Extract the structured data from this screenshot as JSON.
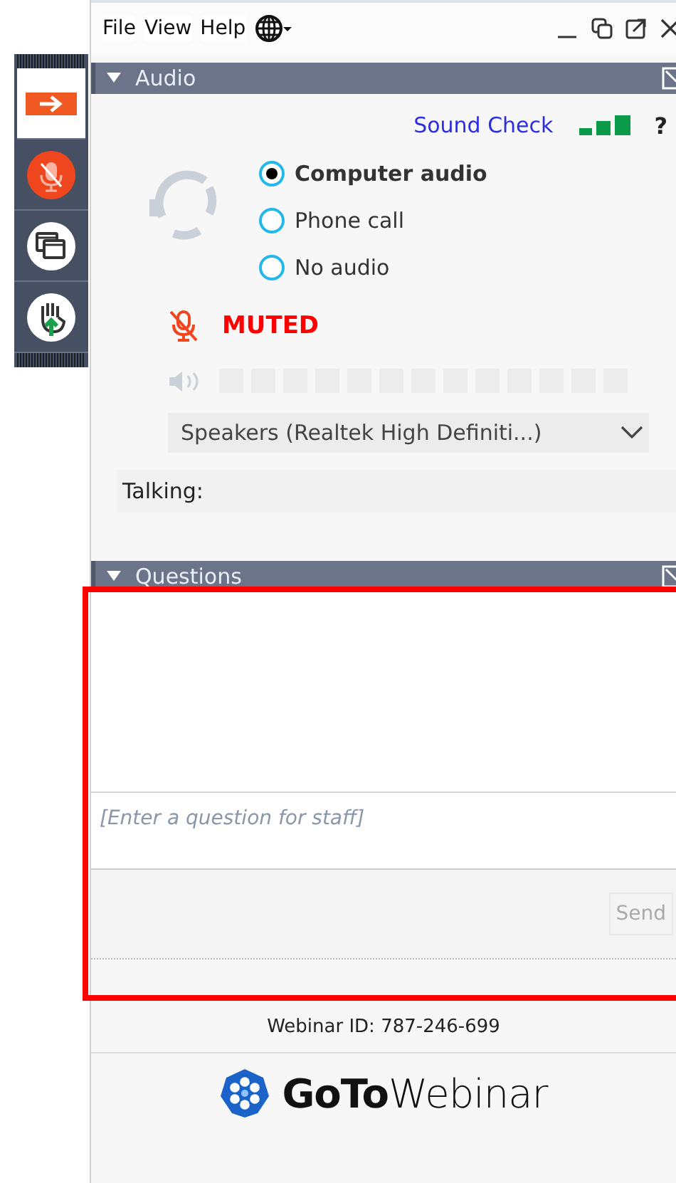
{
  "menu": [
    "File",
    "View",
    "Help"
  ],
  "toolbar": [
    {
      "kind": "arrow",
      "selected": true
    },
    {
      "kind": "mic",
      "selected": false
    },
    {
      "kind": "screen",
      "selected": false
    },
    {
      "kind": "hand",
      "selected": false
    }
  ],
  "audio": {
    "title": "Audio",
    "expanded": true,
    "sound_check": "Sound Check",
    "help": "?",
    "options": [
      {
        "label": "Computer audio",
        "selected": true
      },
      {
        "label": "Phone call",
        "selected": false
      },
      {
        "label": "No audio",
        "selected": false
      }
    ],
    "muted": true,
    "status": "MUTED",
    "speakers": "Speakers (Realtek High Definiti...)",
    "talking": "Talking:"
  },
  "questions": {
    "title": "Questions",
    "expanded": true,
    "placeholder": "[Enter a question for staff]",
    "send": {
      "label": "Send",
      "disabled": true
    }
  },
  "webinar_id": "Webinar ID: 787-246-699",
  "logo": "**GoTo**Webinar"
}
